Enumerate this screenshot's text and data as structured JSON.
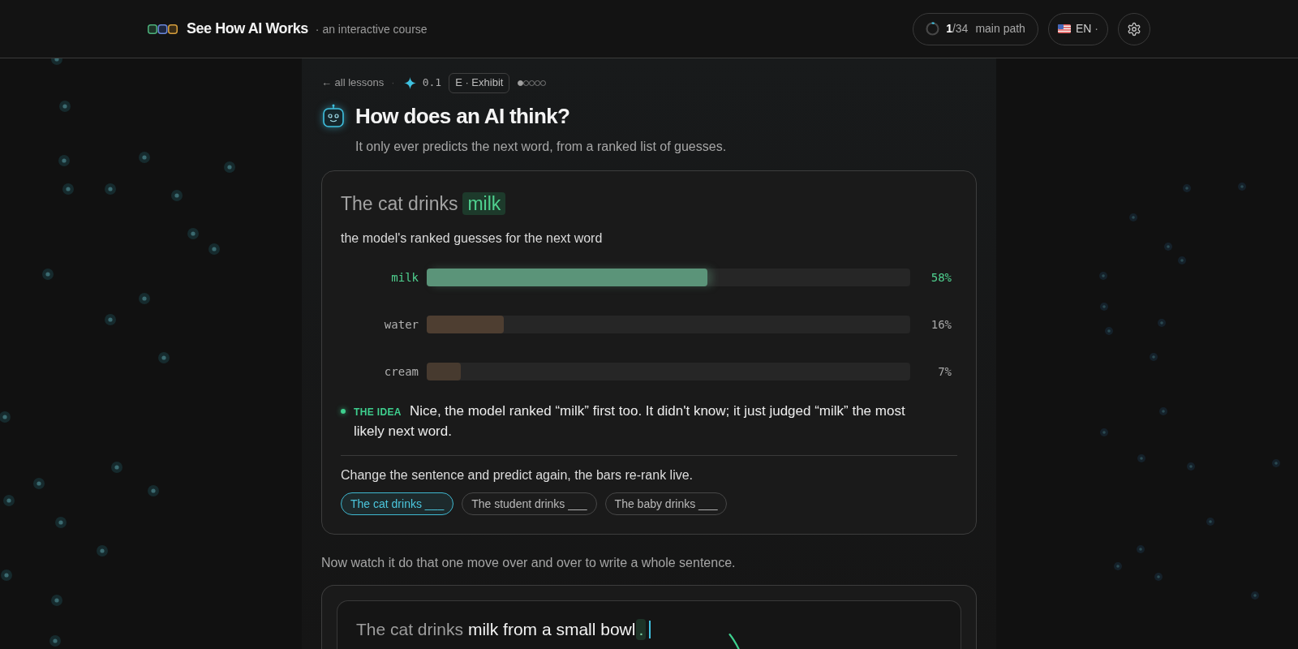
{
  "header": {
    "title": "See How AI Works",
    "tagline": "· an interactive course",
    "progress": {
      "current": "1",
      "total": "/34",
      "label": "main path"
    },
    "language": {
      "label": "EN",
      "caret": "·"
    }
  },
  "breadcrumb": {
    "back": "← all lessons",
    "separator": "·",
    "lesson_number": "0.1",
    "badge": "E · Exhibit",
    "steps": [
      {
        "done": true
      },
      {
        "done": false
      },
      {
        "done": false
      },
      {
        "done": false
      },
      {
        "done": false
      }
    ]
  },
  "lesson": {
    "title": "How does an AI think?",
    "subtitle": "It only ever predicts the next word, from a ranked list of guesses."
  },
  "exhibit": {
    "prompt": "The cat drinks",
    "prediction": "milk",
    "caption": "the model's ranked guesses for the next word",
    "guesses": [
      {
        "word": "milk",
        "top": true,
        "level": 0.58,
        "percent": "58%"
      },
      {
        "word": "water",
        "top": false,
        "level": 0.16,
        "percent": "16%"
      },
      {
        "word": "cream",
        "top": false,
        "level": 0.07,
        "percent": "7%"
      }
    ],
    "idea": {
      "label": "THE IDEA",
      "text": "Nice, the model ranked “milk” first too. It didn't know; it just judged “milk” the most likely next word."
    },
    "instruction": "Change the sentence and predict again, the bars re-rank live.",
    "sentences": [
      {
        "label": "The cat drinks ___",
        "selected": true
      },
      {
        "label": "The student drinks ___",
        "selected": false
      },
      {
        "label": "The baby drinks ___",
        "selected": false
      }
    ]
  },
  "generator": {
    "intro": "Now watch it do that one move over and over to write a whole sentence.",
    "prompt": "The cat drinks",
    "generated": "milk from a small bowl",
    "next_token": "."
  }
}
